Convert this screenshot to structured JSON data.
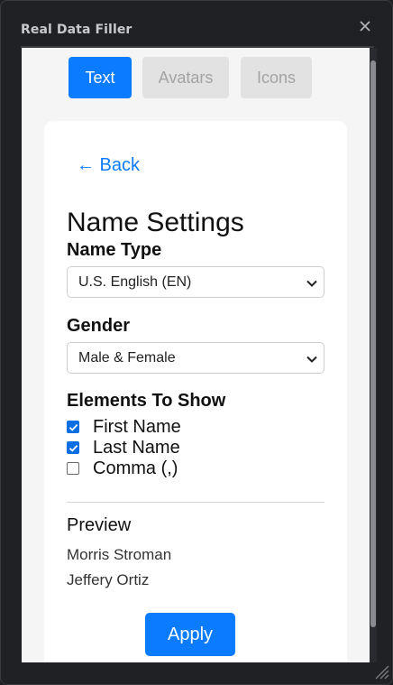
{
  "window": {
    "title": "Real Data Filler"
  },
  "tabs": [
    {
      "label": "Text",
      "active": true
    },
    {
      "label": "Avatars",
      "active": false
    },
    {
      "label": "Icons",
      "active": false
    }
  ],
  "card": {
    "back_label": "← Back",
    "heading": "Name Settings",
    "name_type": {
      "label": "Name Type",
      "selected": "U.S. English (EN)"
    },
    "gender": {
      "label": "Gender",
      "selected": "Male & Female"
    },
    "elements": {
      "label": "Elements To Show",
      "options": [
        {
          "label": "First Name",
          "checked": true
        },
        {
          "label": "Last Name",
          "checked": true
        },
        {
          "label": "Comma (,)",
          "checked": false
        }
      ]
    },
    "preview": {
      "title": "Preview",
      "lines": [
        "Morris Stroman",
        "Jeffery Ortiz"
      ]
    },
    "apply_label": "Apply"
  },
  "colors": {
    "accent": "#0b7bff",
    "window_bg": "#202124",
    "content_bg": "#f5f5f5"
  }
}
